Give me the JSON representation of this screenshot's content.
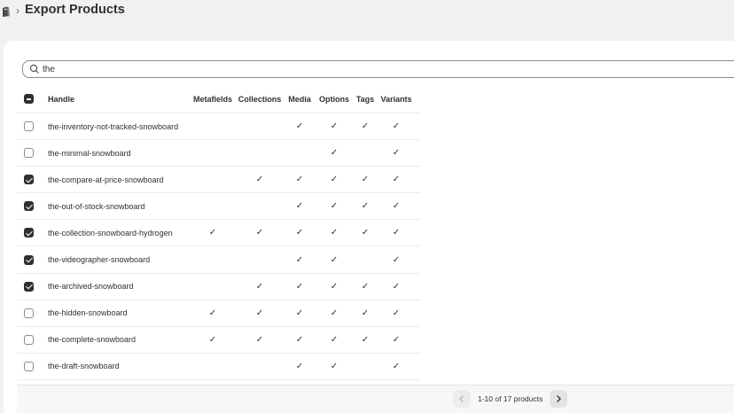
{
  "header": {
    "separator": "›",
    "title": "Export Products"
  },
  "search": {
    "value": "the",
    "placeholder": ""
  },
  "table": {
    "columns": {
      "handle": "Handle",
      "metafields": "Metafields",
      "collections": "Collections",
      "media": "Media",
      "options": "Options",
      "tags": "Tags",
      "variants": "Variants"
    },
    "check_mark": "✓",
    "rows": [
      {
        "handle": "the-inventory-not-tracked-snowboard",
        "checked": false,
        "metafields": false,
        "collections": false,
        "media": true,
        "options": true,
        "tags": true,
        "variants": true
      },
      {
        "handle": "the-minimal-snowboard",
        "checked": false,
        "metafields": false,
        "collections": false,
        "media": false,
        "options": true,
        "tags": false,
        "variants": true
      },
      {
        "handle": "the-compare-at-price-snowboard",
        "checked": true,
        "metafields": false,
        "collections": true,
        "media": true,
        "options": true,
        "tags": true,
        "variants": true
      },
      {
        "handle": "the-out-of-stock-snowboard",
        "checked": true,
        "metafields": false,
        "collections": false,
        "media": true,
        "options": true,
        "tags": true,
        "variants": true
      },
      {
        "handle": "the-collection-snowboard-hydrogen",
        "checked": true,
        "metafields": true,
        "collections": true,
        "media": true,
        "options": true,
        "tags": true,
        "variants": true
      },
      {
        "handle": "the-videographer-snowboard",
        "checked": true,
        "metafields": false,
        "collections": false,
        "media": true,
        "options": true,
        "tags": false,
        "variants": true
      },
      {
        "handle": "the-archived-snowboard",
        "checked": true,
        "metafields": false,
        "collections": true,
        "media": true,
        "options": true,
        "tags": true,
        "variants": true
      },
      {
        "handle": "the-hidden-snowboard",
        "checked": false,
        "metafields": true,
        "collections": true,
        "media": true,
        "options": true,
        "tags": true,
        "variants": true
      },
      {
        "handle": "the-complete-snowboard",
        "checked": false,
        "metafields": true,
        "collections": true,
        "media": true,
        "options": true,
        "tags": true,
        "variants": true
      },
      {
        "handle": "the-draft-snowboard",
        "checked": false,
        "metafields": false,
        "collections": false,
        "media": true,
        "options": true,
        "tags": false,
        "variants": true
      }
    ]
  },
  "pagination": {
    "label": "1-10 of 17 products",
    "prev_icon": "chevron-left-icon",
    "next_icon": "chevron-right-icon"
  }
}
